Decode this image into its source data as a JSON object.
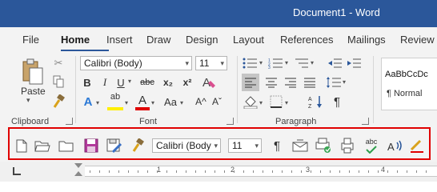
{
  "window": {
    "title": "Document1  -  Word"
  },
  "tabs": [
    {
      "label": "File"
    },
    {
      "label": "Home"
    },
    {
      "label": "Insert"
    },
    {
      "label": "Draw"
    },
    {
      "label": "Design"
    },
    {
      "label": "Layout"
    },
    {
      "label": "References"
    },
    {
      "label": "Mailings"
    },
    {
      "label": "Review"
    }
  ],
  "active_tab": "Home",
  "ribbon": {
    "clipboard": {
      "label": "Clipboard",
      "paste_label": "Paste"
    },
    "font": {
      "label": "Font",
      "font_name": "Calibri (Body)",
      "font_size": "11",
      "bold": "B",
      "italic": "I",
      "underline": "U",
      "strikethrough": "abc",
      "subscript": "x₂",
      "superscript": "x²",
      "text_effects": "A",
      "highlight": "ab",
      "font_color": "A",
      "change_case": "Aa",
      "grow_font": "A^",
      "shrink_font": "Aˇ"
    },
    "paragraph": {
      "label": "Paragraph",
      "pilcrow": "¶"
    },
    "styles": {
      "sample": "AaBbCcDc",
      "normal_label": "¶ Normal"
    }
  },
  "qat": {
    "font_name": "Calibri (Body",
    "font_size": "11",
    "pilcrow": "¶",
    "spelling": "abc"
  },
  "ruler": {
    "numbers": [
      "1",
      "2",
      "3",
      "4"
    ]
  },
  "colors": {
    "title_bar": "#2b579a",
    "highlight_border": "#e00000",
    "highlight_yellow": "#ffef00",
    "font_color_red": "#e00000"
  }
}
